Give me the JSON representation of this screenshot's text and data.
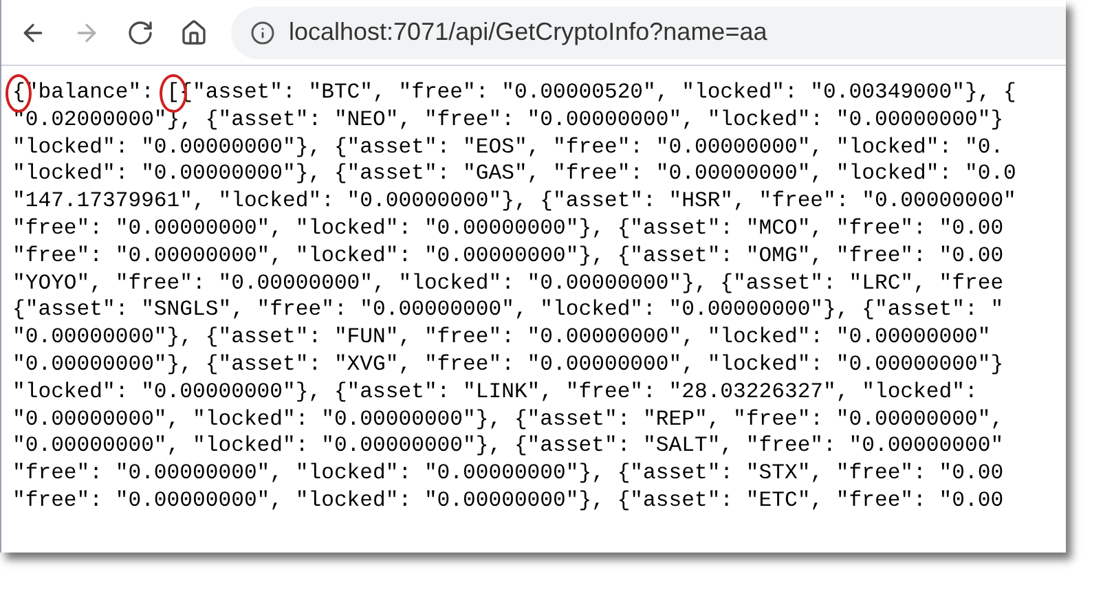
{
  "toolbar": {
    "buttons": [
      {
        "kind": "back",
        "disabled": false
      },
      {
        "kind": "forward",
        "disabled": true
      },
      {
        "kind": "reload",
        "disabled": false
      },
      {
        "kind": "home",
        "disabled": false
      }
    ]
  },
  "address_bar": {
    "url": "localhost:7071/api/GetCryptoInfo?name=aa"
  },
  "body": {
    "lines": [
      {
        "segments": [
          {
            "text": "{",
            "circled": true
          },
          {
            "text": "\"balance\": ",
            "circled": false
          },
          {
            "text": "[",
            "circled": true
          },
          {
            "text": "{\"asset\": \"BTC\", \"free\": \"0.00000520\", \"locked\": \"0.00349000\"}, {",
            "circled": false
          }
        ]
      },
      {
        "segments": [
          {
            "text": "\"0.02000000\"}, {\"asset\": \"NEO\", \"free\": \"0.00000000\", \"locked\": \"0.00000000\"}",
            "circled": false
          }
        ]
      },
      {
        "segments": [
          {
            "text": "\"locked\": \"0.00000000\"}, {\"asset\": \"EOS\", \"free\": \"0.00000000\", \"locked\": \"0.",
            "circled": false
          }
        ]
      },
      {
        "segments": [
          {
            "text": "\"locked\": \"0.00000000\"}, {\"asset\": \"GAS\", \"free\": \"0.00000000\", \"locked\": \"0.0",
            "circled": false
          }
        ]
      },
      {
        "segments": [
          {
            "text": "\"147.17379961\", \"locked\": \"0.00000000\"}, {\"asset\": \"HSR\", \"free\": \"0.00000000\"",
            "circled": false
          }
        ]
      },
      {
        "segments": [
          {
            "text": "\"free\": \"0.00000000\", \"locked\": \"0.00000000\"}, {\"asset\": \"MCO\", \"free\": \"0.00",
            "circled": false
          }
        ]
      },
      {
        "segments": [
          {
            "text": "\"free\": \"0.00000000\", \"locked\": \"0.00000000\"}, {\"asset\": \"OMG\", \"free\": \"0.00",
            "circled": false
          }
        ]
      },
      {
        "segments": [
          {
            "text": "\"YOYO\", \"free\": \"0.00000000\", \"locked\": \"0.00000000\"}, {\"asset\": \"LRC\", \"free",
            "circled": false
          }
        ]
      },
      {
        "segments": [
          {
            "text": "{\"asset\": \"SNGLS\", \"free\": \"0.00000000\", \"locked\": \"0.00000000\"}, {\"asset\": \"",
            "circled": false
          }
        ]
      },
      {
        "segments": [
          {
            "text": "\"0.00000000\"}, {\"asset\": \"FUN\", \"free\": \"0.00000000\", \"locked\": \"0.00000000\"",
            "circled": false
          }
        ]
      },
      {
        "segments": [
          {
            "text": "\"0.00000000\"}, {\"asset\": \"XVG\", \"free\": \"0.00000000\", \"locked\": \"0.00000000\"}",
            "circled": false
          }
        ]
      },
      {
        "segments": [
          {
            "text": "\"locked\": \"0.00000000\"}, {\"asset\": \"LINK\", \"free\": \"28.03226327\", \"locked\":",
            "circled": false
          }
        ]
      },
      {
        "segments": [
          {
            "text": "\"0.00000000\", \"locked\": \"0.00000000\"}, {\"asset\": \"REP\", \"free\": \"0.00000000\",",
            "circled": false
          }
        ]
      },
      {
        "segments": [
          {
            "text": "\"0.00000000\", \"locked\": \"0.00000000\"}, {\"asset\": \"SALT\", \"free\": \"0.00000000\"",
            "circled": false
          }
        ]
      },
      {
        "segments": [
          {
            "text": "\"free\": \"0.00000000\", \"locked\": \"0.00000000\"}, {\"asset\": \"STX\", \"free\": \"0.00",
            "circled": false
          }
        ]
      },
      {
        "segments": [
          {
            "text": "\"free\": \"0.00000000\", \"locked\": \"0.00000000\"}, {\"asset\": \"ETC\", \"free\": \"0.00",
            "circled": false
          }
        ]
      }
    ]
  }
}
